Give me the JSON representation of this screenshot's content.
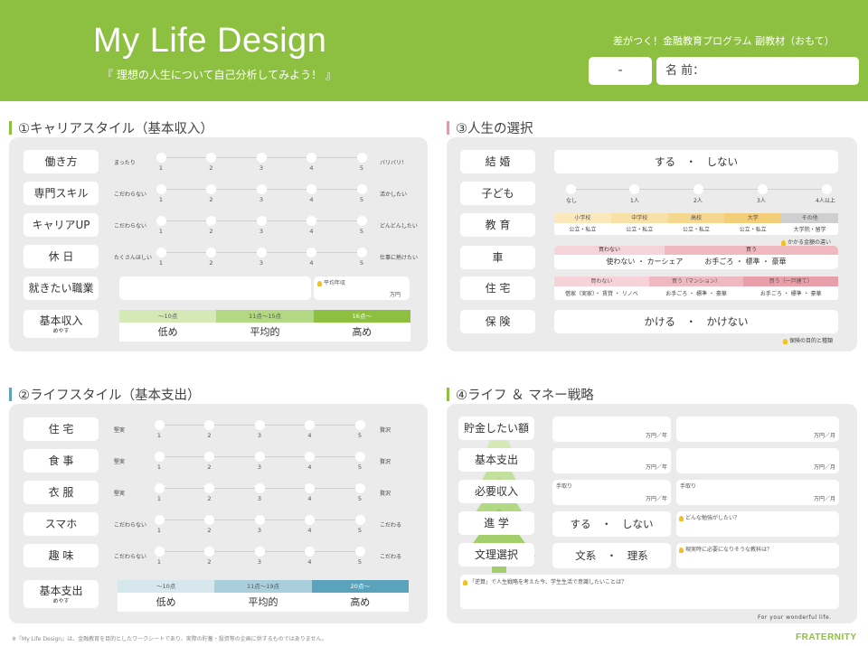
{
  "header": {
    "title": "My Life Design",
    "subtitle": "『 理想の人生について自己分析してみよう！ 』",
    "program": "差がつく！金融教育プログラム 副教材（おもて）",
    "class_field": "-",
    "name_field": "名 前："
  },
  "colors": {
    "green": "#8dc040",
    "blue": "#5ba3bd",
    "pink": "#d9a0a8"
  },
  "section1": {
    "heading": "①キャリアスタイル（基本収入）",
    "rows": [
      {
        "label": "働き方",
        "left": "まったり",
        "right": "バリバリ！"
      },
      {
        "label": "専門スキル",
        "left": "こだわらない",
        "right": "活かしたい"
      },
      {
        "label": "キャリアUP",
        "left": "こだわらない",
        "right": "どんどんしたい"
      },
      {
        "label": "休 日",
        "left": "たくさんほしい",
        "right": "仕事に熱けたい"
      }
    ],
    "scale_numbers": [
      "1",
      "2",
      "3",
      "4",
      "5"
    ],
    "job_label": "就きたい職業",
    "avg_income_label": "平均年収",
    "avg_income_unit": "万円",
    "income_label": "基本収入",
    "income_sub": "めやす",
    "income_ranges": [
      "～10点",
      "11点～15点",
      "16点～"
    ],
    "income_levels": [
      "低め",
      "平均的",
      "高め"
    ]
  },
  "section2": {
    "heading": "②ライフスタイル（基本支出）",
    "rows": [
      {
        "label": "住 宅",
        "left": "堅実",
        "right": "贅沢"
      },
      {
        "label": "食 事",
        "left": "堅実",
        "right": "贅沢"
      },
      {
        "label": "衣 服",
        "left": "堅実",
        "right": "贅沢"
      },
      {
        "label": "スマホ",
        "left": "こだわらない",
        "right": "こだわる"
      },
      {
        "label": "趣 味",
        "left": "こだわらない",
        "right": "こだわる"
      }
    ],
    "scale_numbers": [
      "1",
      "2",
      "3",
      "4",
      "5"
    ],
    "expense_label": "基本支出",
    "expense_sub": "めやす",
    "expense_ranges": [
      "～10点",
      "11点～19点",
      "20点～"
    ],
    "expense_levels": [
      "低め",
      "平均的",
      "高め"
    ]
  },
  "section3": {
    "heading": "③人生の選択",
    "marriage": {
      "label": "結 婚",
      "value": "する　・　しない"
    },
    "children": {
      "label": "子ども",
      "options": [
        "なし",
        "1人",
        "2人",
        "3人",
        "4人以上"
      ]
    },
    "education": {
      "label": "教 育",
      "stages": [
        "小学校",
        "中学校",
        "高校",
        "大学",
        "その他"
      ],
      "values": [
        "公立・私立",
        "公立・私立",
        "公立・私立",
        "公立・私立",
        "大学院・留学"
      ],
      "note": "かかる金額の違い"
    },
    "car": {
      "label": "車",
      "headers": [
        "買わない",
        "買う"
      ],
      "value": "使わない ・ カーシェア　　　お手ごろ ・ 標準 ・ 豪華"
    },
    "housing": {
      "label": "住 宅",
      "headers": [
        "買わない",
        "買う（マンション）",
        "買う（一戸建て）"
      ],
      "values": [
        "借家（実家）・ 賃貸 ・ リノベ",
        "お手ごろ ・ 標準 ・ 豪華",
        "お手ごろ ・ 標準 ・ 豪華"
      ]
    },
    "insurance": {
      "label": "保 険",
      "value": "かける　・　かけない",
      "note": "保険の目的と種類"
    }
  },
  "section4": {
    "heading": "④ライフ ＆ マネー戦略",
    "savings": {
      "label": "貯金したい額",
      "unit1": "万円／年",
      "unit2": "万円／月"
    },
    "basic_expense": {
      "label": "基本支出",
      "unit1": "万円／年",
      "unit2": "万円／月"
    },
    "required_income": {
      "label": "必要収入",
      "take_home": "手取り",
      "unit1": "万円／年",
      "unit2": "万円／月"
    },
    "further_study": {
      "label": "進 学",
      "value": "する　・　しない",
      "note": "どんな勉強がしたい？"
    },
    "track": {
      "label": "文理選択",
      "value": "文系　・　理系",
      "note": "現実時に必要になりそうな教科は？"
    },
    "question": "「逆算」で人生戦略を考えた今、学生生活で意識したいことは？",
    "tagline": "For your wonderful life."
  },
  "footer": {
    "note": "※『My Life Design』は、金融教育を目的としたワークシートであり、実際の貯蓄・投資等の企画に供するものではありません。",
    "brand": "FRATERNITY"
  }
}
